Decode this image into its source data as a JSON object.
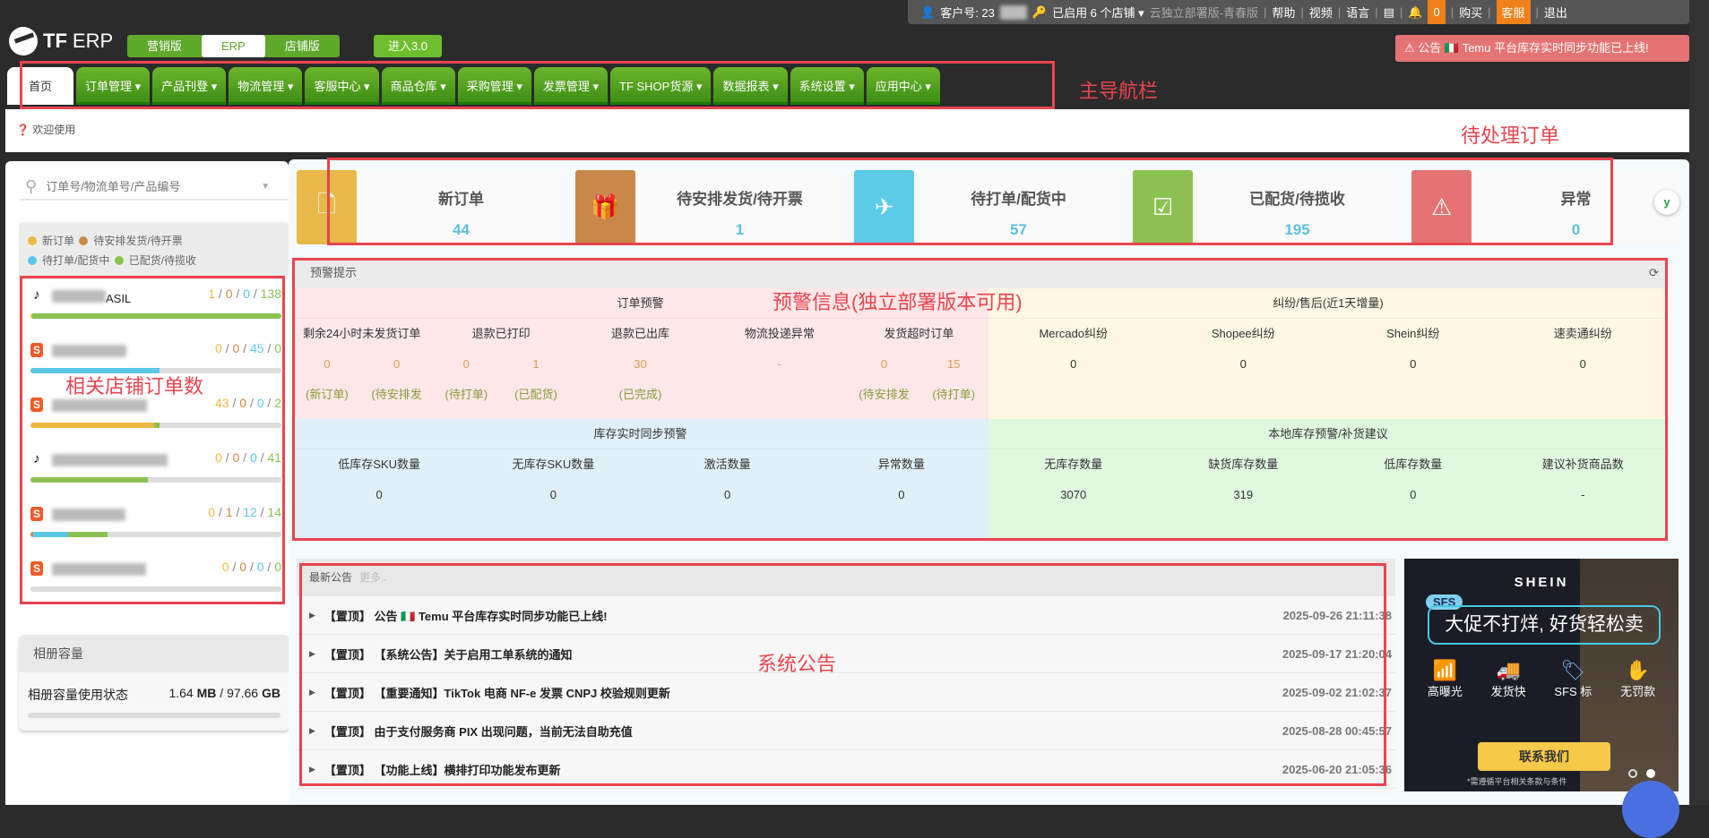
{
  "userbar": {
    "customer_label": "客户号: 23",
    "stores": "已启用 6 个店铺 ▾",
    "edition": "云独立部署版-青春版",
    "help": "帮助",
    "video": "视频",
    "language": "语言",
    "notif_count": "0",
    "buy": "购买",
    "service": "客服",
    "logout": "退出"
  },
  "logo": {
    "text_tf": "TF",
    "text_erp": "ERP"
  },
  "versions": [
    "营销版",
    "ERP",
    "店铺版"
  ],
  "enter3": "进入3.0",
  "notice": "公告 🇮🇹 Temu 平台库存实时同步功能已上线!",
  "nav": [
    "首页",
    "订单管理 ▾",
    "产品刊登 ▾",
    "物流管理 ▾",
    "客服中心 ▾",
    "商品仓库 ▾",
    "采购管理 ▾",
    "发票管理 ▾",
    "TF SHOP货源 ▾",
    "数据报表 ▾",
    "系统设置 ▾",
    "应用中心 ▾"
  ],
  "welcome": "欢迎使用",
  "sidebar": {
    "search_placeholder": "订单号/物流单号/产品编号",
    "legend": [
      "新订单",
      "待安排发货/待开票",
      "待打单/配货中",
      "已配货/待揽收"
    ],
    "legend_colors": [
      "#f0b840",
      "#cc8a45",
      "#5bc8e8",
      "#8cc152"
    ],
    "stores": [
      {
        "platform": "tiktok",
        "name_suffix": "ASIL",
        "counts": [
          1,
          0,
          0,
          138
        ]
      },
      {
        "platform": "shopee",
        "name_suffix": "",
        "counts": [
          0,
          0,
          45,
          0
        ]
      },
      {
        "platform": "shopee",
        "name_suffix": "",
        "counts": [
          43,
          0,
          0,
          2
        ]
      },
      {
        "platform": "tiktok",
        "name_suffix": "",
        "counts": [
          0,
          0,
          0,
          41
        ]
      },
      {
        "platform": "shopee",
        "name_suffix": "",
        "counts": [
          0,
          1,
          12,
          14
        ]
      },
      {
        "platform": "shopee",
        "name_suffix": "",
        "counts": [
          0,
          0,
          0,
          0
        ]
      }
    ],
    "album": {
      "title": "相册容量",
      "label": "相册容量使用状态",
      "used": "1.64",
      "used_unit": "MB",
      "sep": "/",
      "total": "97.66",
      "total_unit": "GB",
      "fraction": 2e-05
    }
  },
  "cards": [
    {
      "title": "新订单",
      "value": "44",
      "color": "#e8b84a",
      "icon": "file-icon"
    },
    {
      "title": "待安排发货/待开票",
      "value": "1",
      "color": "#c9884a",
      "icon": "gift-icon"
    },
    {
      "title": "待打单/配货中",
      "value": "57",
      "color": "#5bcbe8",
      "icon": "plane-icon"
    },
    {
      "title": "已配货/待揽收",
      "value": "195",
      "color": "#8cc152",
      "icon": "check-icon"
    },
    {
      "title": "异常",
      "value": "0",
      "color": "#e57373",
      "icon": "warning-icon"
    }
  ],
  "alert": {
    "title": "预警提示",
    "order": {
      "title": "订单预警",
      "labels": [
        "剩余24小时未发货订单",
        "退款已打印",
        "退款已出库",
        "物流投递异常",
        "发货超时订单"
      ],
      "values": [
        [
          "0",
          "0"
        ],
        [
          "0",
          "1"
        ],
        [
          "30"
        ],
        [
          "-"
        ],
        [
          "0",
          "15"
        ]
      ],
      "subs": [
        [
          "(新订单)",
          "(待安排发"
        ],
        [
          "(待打单)",
          "(已配货)"
        ],
        [
          "(已完成)"
        ],
        [],
        [
          "(待安排发",
          "(待打单)"
        ]
      ]
    },
    "dispute": {
      "title": "纠纷/售后(近1天增量)",
      "labels": [
        "Mercado纠纷",
        "Shopee纠纷",
        "Shein纠纷",
        "速卖通纠纷"
      ],
      "values": [
        "0",
        "0",
        "0",
        "0"
      ]
    },
    "sync": {
      "title": "库存实时同步预警",
      "labels": [
        "低库存SKU数量",
        "无库存SKU数量",
        "激活数量",
        "异常数量"
      ],
      "values": [
        "0",
        "0",
        "0",
        "0"
      ]
    },
    "local": {
      "title": "本地库存预警/补货建议",
      "labels": [
        "无库存数量",
        "缺货库存数量",
        "低库存数量",
        "建议补货商品数"
      ],
      "values": [
        "3070",
        "319",
        "0",
        "-"
      ]
    }
  },
  "announcements": {
    "title": "最新公告",
    "more": "更多..",
    "items": [
      {
        "text": "【置顶】 公告 🇮🇹 Temu 平台库存实时同步功能已上线!",
        "date": "2025-09-26 21:11:38"
      },
      {
        "text": "【置顶】 【系统公告】关于启用工单系统的通知",
        "date": "2025-09-17 21:20:04"
      },
      {
        "text": "【置顶】 【重要通知】TikTok 电商 NF-e 发票 CNPJ 校验规则更新",
        "date": "2025-09-02 21:02:37"
      },
      {
        "text": "【置顶】 由于支付服务商 PIX 出现问题，当前无法自助充值",
        "date": "2025-08-28 00:45:57"
      },
      {
        "text": "【置顶】 【功能上线】横排打印功能发布更新",
        "date": "2025-06-20 21:05:36"
      }
    ]
  },
  "ad": {
    "brand": "SHEIN",
    "badge": "SFS",
    "headline": "大促不打烊, 好货轻松卖",
    "features": [
      "高曝光",
      "发货快",
      "SFS 标",
      "无罚款"
    ],
    "cta": "联系我们",
    "footnote": "*需遵循平台相关条款与条件"
  },
  "annotations": {
    "nav": "主导航栏",
    "pending": "待处理订单",
    "stores": "相关店铺订单数",
    "alert": "预警信息(独立部署版本可用)",
    "ann": "系统公告"
  }
}
